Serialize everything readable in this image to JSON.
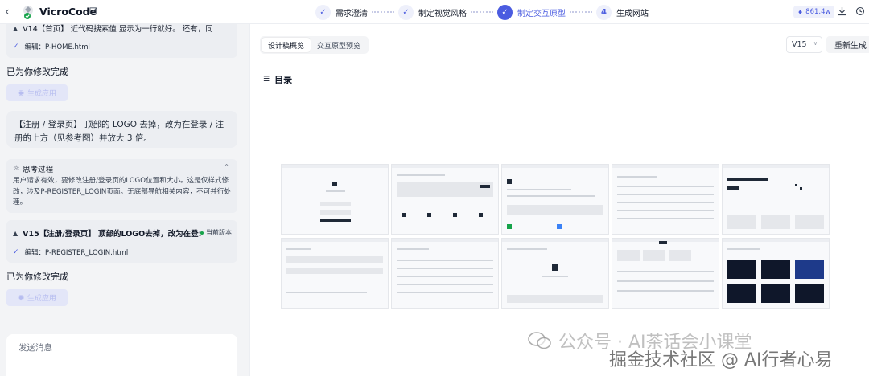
{
  "topbar": {
    "app_title": "VicroCode",
    "steps": [
      {
        "num": "✓",
        "label": "需求澄清",
        "state": "done"
      },
      {
        "num": "✓",
        "label": "制定视觉风格",
        "state": "done"
      },
      {
        "num": "✓",
        "label": "制定交互原型",
        "state": "active"
      },
      {
        "num": "4",
        "label": "生成网站",
        "state": "todo"
      }
    ],
    "credits": "861.4w"
  },
  "chat": {
    "v14_title": "V14【首页】 近代码搜索值 显示为一行就好。 还有，同",
    "v14_file": "编辑：P-HOME.html",
    "done_text_1": "已为你修改完成",
    "gen_button": "生成应用",
    "user_message": "【注册 / 登录页】 顶部的 LOGO 去掉，改为在登录 / 注册的上方（见参考图）并放大 3 倍。",
    "thinking_title": "思考过程",
    "thinking_body": "用户请求有效，要修改注册/登录页的LOGO位置和大小。这是仅样式修改，涉及P-REGISTER_LOGIN页面。无底部导航相关内容，不可并行处理。",
    "v15_title": "V15【注册/登录页】 顶部的LOGO去掉，改为在登:",
    "current_badge": "当前版本",
    "v15_file": "编辑：P-REGISTER_LOGIN.html",
    "done_text_2": "已为你修改完成",
    "input_placeholder": "发送消息"
  },
  "preview": {
    "tabs": [
      "设计稿概览",
      "交互原型预览"
    ],
    "version": "V15",
    "regen_button": "重新生成",
    "toc_label": "目录"
  },
  "watermark": {
    "line1": "公众号 · AI茶话会小课堂",
    "line2": "掘金技术社区 @ AI行者心易"
  },
  "colors": {
    "accent": "#4b5ce0",
    "accent_light": "#eef0fb"
  }
}
